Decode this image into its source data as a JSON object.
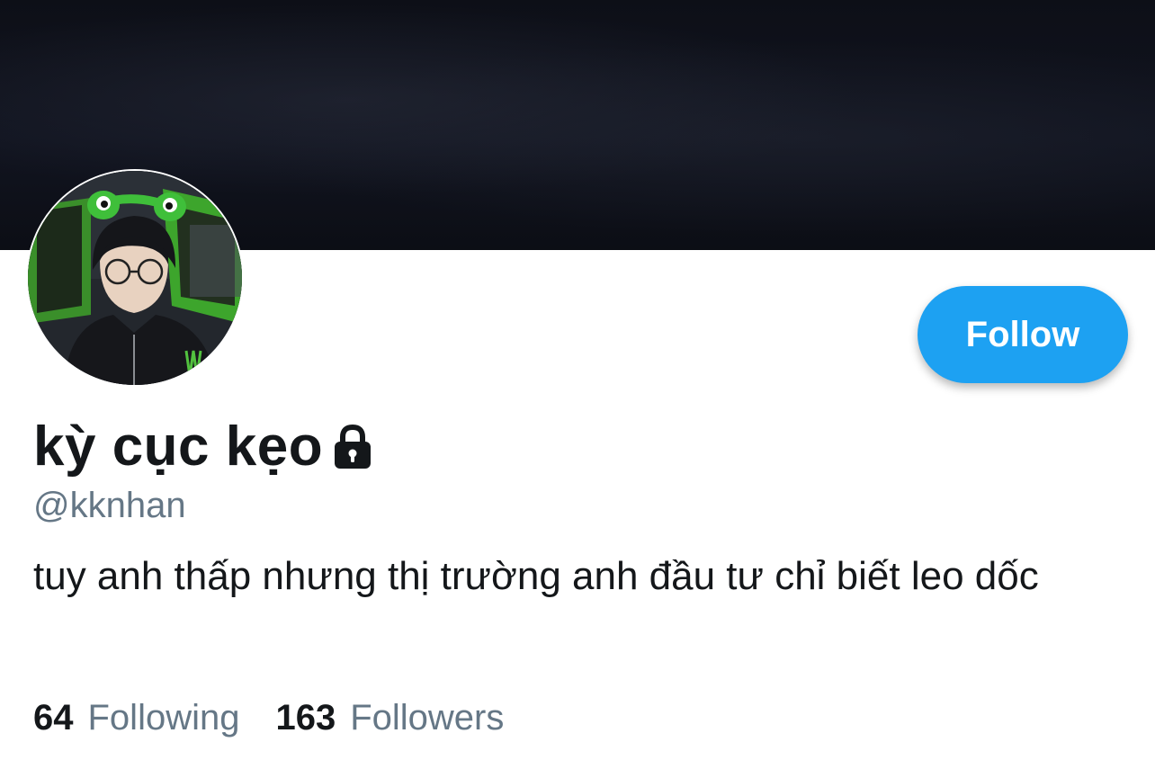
{
  "profile": {
    "display_name": "kỳ cục kẹo",
    "handle": "@kknhan",
    "bio": "tuy anh thấp nhưng thị trường anh đầu tư chỉ biết leo dốc",
    "protected_icon": "lock-icon",
    "avatar_icon": "profile-photo"
  },
  "actions": {
    "follow_label": "Follow"
  },
  "stats": {
    "following_count": "64",
    "following_label": "Following",
    "followers_count": "163",
    "followers_label": "Followers"
  },
  "colors": {
    "accent": "#1da1f2",
    "text_primary": "#14171a",
    "text_secondary": "#657786",
    "banner": "#0f111a"
  }
}
